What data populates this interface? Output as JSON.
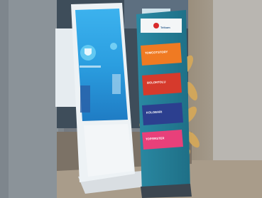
{
  "scene": {
    "description_name": "exhibition-kiosk-photo",
    "colors": {
      "screen_blue": "#2fa3e6",
      "stand_white": "#e8eef2",
      "pillar_teal": "#2b8fa8",
      "sign_orange": "#f07a22",
      "sign_red": "#d63a2c",
      "sign_navy": "#2c3f8f",
      "sign_pink": "#e8407a",
      "leaf_gold": "#d4a85a"
    }
  },
  "pillar": {
    "brand": "Telkom",
    "signs": [
      {
        "label": "TOMCOTSTORY"
      },
      {
        "label": "BOLONTOLU"
      },
      {
        "label": "KOLOBARI"
      },
      {
        "label": "TOPFIRSTER"
      }
    ]
  }
}
